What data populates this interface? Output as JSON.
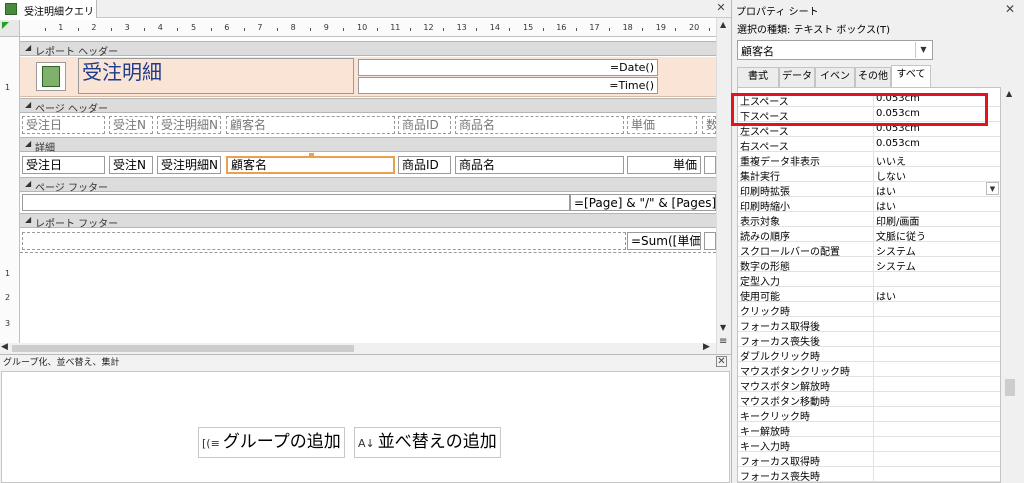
{
  "designer": {
    "tab_title": "受注明細クエリ",
    "close_glyph": "✕",
    "ruler_numbers": [
      "1",
      "2",
      "3",
      "4",
      "5",
      "6",
      "7",
      "8",
      "9",
      "10",
      "11",
      "12",
      "13",
      "14",
      "15",
      "16",
      "17",
      "18",
      "19",
      "20"
    ],
    "vruler_numbers": [
      "1",
      "1",
      "2",
      "3"
    ],
    "sections": {
      "report_header": "レポート ヘッダー",
      "page_header": "ページ ヘッダー",
      "detail": "詳細",
      "page_footer": "ページ フッター",
      "report_footer": "レポート フッター"
    },
    "report_header": {
      "title": "受注明細",
      "date_expr": "=Date()",
      "time_expr": "=Time()"
    },
    "page_header_labels": [
      "受注日",
      "受注N",
      "受注明細N",
      "顧客名",
      "商品ID",
      "商品名",
      "単価",
      "数"
    ],
    "detail_fields": [
      "受注日",
      "受注N",
      "受注明細N",
      "顧客名",
      "商品ID",
      "商品名",
      "単価"
    ],
    "page_footer_expr": "=[Page] & \"/\" & [Pages]",
    "report_footer_expr": "=Sum([単価"
  },
  "group_pane": {
    "title": "グループ化、並べ替え、集計",
    "add_group": "グループの追加",
    "add_group_icon": "[(≡",
    "add_sort": "並べ替えの追加",
    "add_sort_icon": "A↓",
    "close_glyph": "✕"
  },
  "property_sheet": {
    "title": "プロパティ シート",
    "selection_type": "選択の種類: テキスト ボックス(T)",
    "selected_control": "顧客名",
    "tabs": [
      "書式",
      "データ",
      "イベント",
      "その他",
      "すべて"
    ],
    "active_tab": "すべて",
    "rows": [
      {
        "name": "上スペース",
        "value": "0.053cm"
      },
      {
        "name": "下スペース",
        "value": "0.053cm"
      },
      {
        "name": "左スペース",
        "value": "0.053cm"
      },
      {
        "name": "右スペース",
        "value": "0.053cm"
      },
      {
        "name": "重複データ非表示",
        "value": "いいえ"
      },
      {
        "name": "集計実行",
        "value": "しない"
      },
      {
        "name": "印刷時拡張",
        "value": "はい"
      },
      {
        "name": "印刷時縮小",
        "value": "はい"
      },
      {
        "name": "表示対象",
        "value": "印刷/画面"
      },
      {
        "name": "読みの順序",
        "value": "文脈に従う"
      },
      {
        "name": "スクロールバーの配置",
        "value": "システム"
      },
      {
        "name": "数字の形態",
        "value": "システム"
      },
      {
        "name": "定型入力",
        "value": ""
      },
      {
        "name": "使用可能",
        "value": "はい"
      },
      {
        "name": "クリック時",
        "value": ""
      },
      {
        "name": "フォーカス取得後",
        "value": ""
      },
      {
        "name": "フォーカス喪失後",
        "value": ""
      },
      {
        "name": "ダブルクリック時",
        "value": ""
      },
      {
        "name": "マウスボタンクリック時",
        "value": ""
      },
      {
        "name": "マウスボタン解放時",
        "value": ""
      },
      {
        "name": "マウスボタン移動時",
        "value": ""
      },
      {
        "name": "キークリック時",
        "value": ""
      },
      {
        "name": "キー解放時",
        "value": ""
      },
      {
        "name": "キー入力時",
        "value": ""
      },
      {
        "name": "フォーカス取得時",
        "value": ""
      },
      {
        "name": "フォーカス喪失時",
        "value": ""
      }
    ],
    "highlight_color": "#e0131e"
  }
}
